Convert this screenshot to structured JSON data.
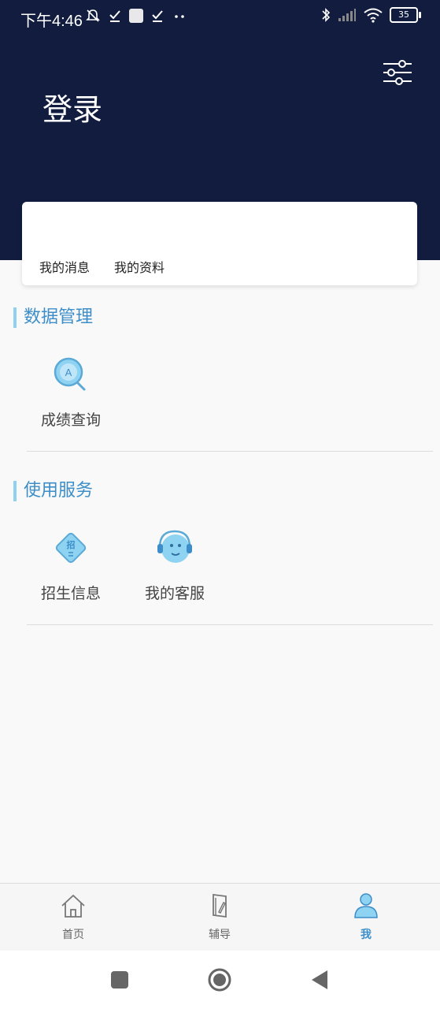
{
  "status_bar": {
    "time": "下午4:46",
    "battery": "35"
  },
  "header": {
    "title": "登录"
  },
  "card": {
    "links": [
      "我的消息",
      "我的资料"
    ]
  },
  "sections": [
    {
      "title": "数据管理",
      "items": [
        {
          "label": "成绩查询",
          "icon": "score-search-icon"
        }
      ]
    },
    {
      "title": "使用服务",
      "items": [
        {
          "label": "招生信息",
          "icon": "admission-info-icon"
        },
        {
          "label": "我的客服",
          "icon": "customer-service-icon"
        }
      ]
    }
  ],
  "tabs": [
    {
      "label": "首页",
      "icon": "home-icon"
    },
    {
      "label": "辅导",
      "icon": "tutoring-book-icon"
    },
    {
      "label": "我",
      "icon": "user-profile-icon",
      "active": true
    }
  ],
  "colors": {
    "header_bg": "#111c3f",
    "accent": "#3d8ec8",
    "section_bar": "#8fd1ee"
  }
}
